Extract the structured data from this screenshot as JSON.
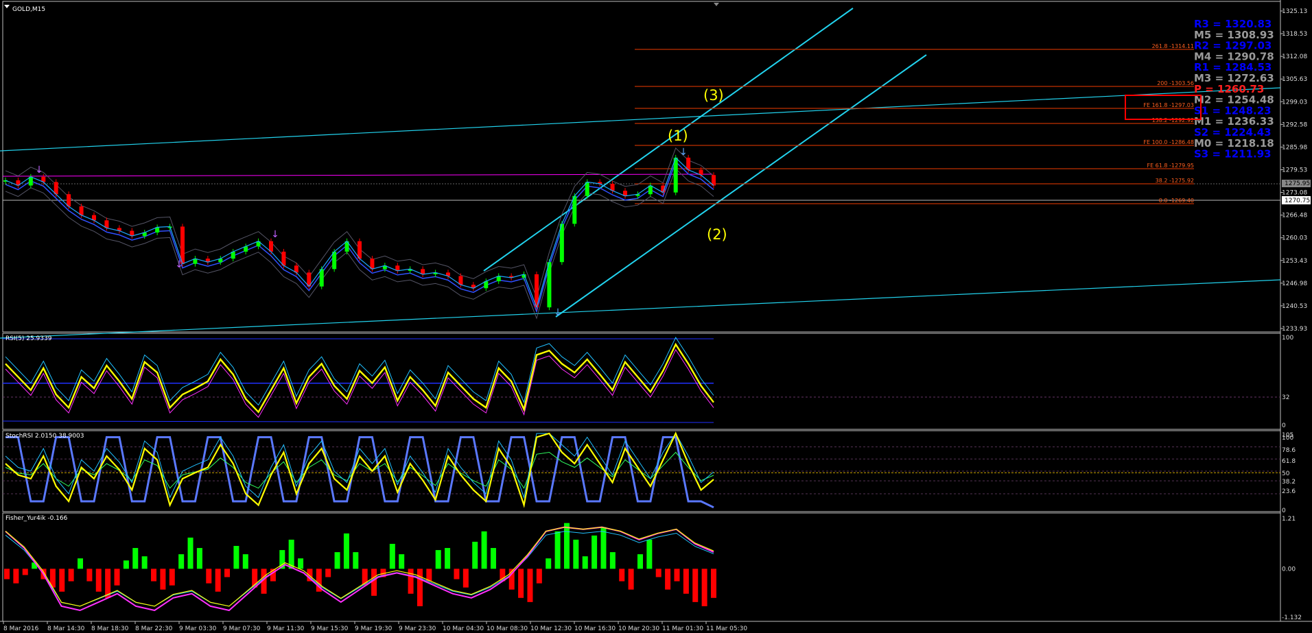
{
  "window": {
    "title": "GOLD,M15"
  },
  "colors": {
    "background": "#000000",
    "grid": "#1a1a1a",
    "panel_border": "#c0c0c0",
    "bull": "#00ff00",
    "bear": "#ff0000",
    "channel": "#22d3ee",
    "pivot_blue": "#0000ff",
    "pivot_grey": "#9a9a9a",
    "pivot_red": "#ff2020",
    "fib": "#c03000",
    "fib_text": "#ff6020",
    "wave": "#ffff00",
    "ma_magenta": "#ff00ff"
  },
  "price_axis": {
    "ticks": [
      "1325.13",
      "1318.53",
      "1312.08",
      "1305.63",
      "1299.03",
      "1292.58",
      "1285.98",
      "1279.53",
      "1273.08",
      "1266.48",
      "1260.03",
      "1253.43",
      "1246.98",
      "1240.53",
      "1233.93"
    ],
    "current_price": "1270.75",
    "bid_box": "1275.95"
  },
  "time_axis": [
    "8 Mar 2016",
    "8 Mar 14:30",
    "8 Mar 18:30",
    "8 Mar 22:30",
    "9 Mar 03:30",
    "9 Mar 07:30",
    "9 Mar 11:30",
    "9 Mar 15:30",
    "9 Mar 19:30",
    "9 Mar 23:30",
    "10 Mar 04:30",
    "10 Mar 08:30",
    "10 Mar 12:30",
    "10 Mar 16:30",
    "10 Mar 20:30",
    "11 Mar 01:30",
    "11 Mar 05:30"
  ],
  "pivots": [
    {
      "label": "R3 = 1320.83",
      "color": "blue"
    },
    {
      "label": "M5 = 1308.93",
      "color": "grey"
    },
    {
      "label": "R2 = 1297.03",
      "color": "blue"
    },
    {
      "label": "M4 = 1290.78",
      "color": "grey"
    },
    {
      "label": "R1 = 1284.53",
      "color": "blue"
    },
    {
      "label": "M3 = 1272.63",
      "color": "grey"
    },
    {
      "label": "P = 1260.73",
      "color": "red"
    },
    {
      "label": "M2 = 1254.48",
      "color": "grey"
    },
    {
      "label": "S1 = 1248.23",
      "color": "blue"
    },
    {
      "label": "M1 = 1236.33",
      "color": "grey"
    },
    {
      "label": "S2 = 1224.43",
      "color": "blue"
    },
    {
      "label": "M0 = 1218.18",
      "color": "grey"
    },
    {
      "label": "S3 = 1211.93",
      "color": "blue"
    }
  ],
  "fib_levels": [
    {
      "label": "261.8 -1314.11"
    },
    {
      "label": "200 -1303.56"
    },
    {
      "label": "FE 161.8 -1297.03"
    },
    {
      "label": "138.2 -1292.92"
    },
    {
      "label": "FE 100.0 -1286.48"
    },
    {
      "label": "FE 61.8 -1279.95"
    },
    {
      "label": "38.2 -1275.92"
    },
    {
      "label": "0.0 -1269.40"
    }
  ],
  "waves": [
    "(1)",
    "(2)",
    "(3)"
  ],
  "chart_data": [
    {
      "type": "line",
      "title": "GOLD,M15",
      "ylim": [
        1233.93,
        1325.13
      ],
      "series": [
        {
          "name": "GOLD",
          "values": [
            1276.5,
            1275,
            1277.5,
            1276,
            1272.5,
            1269,
            1266.5,
            1265,
            1262.8,
            1262,
            1260.5,
            1261.5,
            1263,
            1263.2,
            1252.5,
            1254,
            1253,
            1254,
            1256,
            1257.5,
            1259,
            1256,
            1252,
            1250,
            1246,
            1251,
            1256,
            1259,
            1254,
            1251,
            1252,
            1250.5,
            1251,
            1249.5,
            1250,
            1249,
            1246.5,
            1245.5,
            1247.5,
            1249,
            1248.5,
            1249.5,
            1240,
            1253,
            1264,
            1272,
            1276,
            1275.5,
            1273.5,
            1272,
            1272.5,
            1275,
            1273,
            1283,
            1279.5,
            1278,
            1275
          ]
        }
      ]
    },
    {
      "type": "line",
      "title": "RSI(5) 25.9339",
      "ylim": [
        0,
        100
      ],
      "y_ticks": [
        "100",
        "32",
        "0"
      ],
      "series": [
        {
          "name": "RSI(5)",
          "values": [
            70,
            55,
            40,
            65,
            35,
            20,
            55,
            42,
            68,
            50,
            30,
            72,
            60,
            20,
            35,
            42,
            50,
            75,
            58,
            30,
            15,
            40,
            65,
            25,
            55,
            70,
            45,
            30,
            62,
            48,
            66,
            28,
            55,
            40,
            22,
            60,
            45,
            30,
            20,
            65,
            50,
            18,
            80,
            85,
            70,
            60,
            75,
            58,
            40,
            72,
            55,
            38,
            62,
            92,
            70,
            45,
            26
          ]
        }
      ]
    },
    {
      "type": "line",
      "title": "StochRSI 2.0150 38.9003",
      "y_ticks": [
        "105",
        "78.6",
        "61.8",
        "50",
        "38.2",
        "23.6",
        "0",
        "100"
      ],
      "series": [
        {
          "name": "StochRSI",
          "values": [
            60,
            45,
            40,
            70,
            30,
            10,
            55,
            40,
            70,
            52,
            25,
            80,
            65,
            5,
            40,
            48,
            55,
            85,
            60,
            20,
            5,
            45,
            75,
            20,
            60,
            80,
            40,
            25,
            70,
            50,
            70,
            22,
            60,
            38,
            12,
            70,
            45,
            25,
            10,
            80,
            55,
            5,
            95,
            100,
            75,
            60,
            85,
            60,
            35,
            80,
            55,
            30,
            65,
            100,
            60,
            25,
            39
          ]
        },
        {
          "name": "StochRSI K",
          "values": [
            95,
            95,
            10,
            10,
            95,
            95,
            10,
            10,
            95,
            95,
            10,
            10,
            95,
            95,
            10,
            10,
            95,
            95,
            10,
            10,
            95,
            95,
            10,
            10,
            95,
            95,
            10,
            10,
            95,
            95,
            10,
            10,
            95,
            95,
            10,
            10,
            95,
            95,
            10,
            10,
            95,
            95,
            10,
            10,
            95,
            95,
            10,
            10,
            95,
            95,
            10,
            10,
            95,
            95,
            10,
            10,
            2
          ]
        }
      ]
    },
    {
      "type": "bar",
      "title": "Fisher_Yur4ik -0.166",
      "ylim": [
        -1.132,
        1.21
      ],
      "y_ticks": [
        "1.21",
        "0.00",
        "-1.132"
      ],
      "values": [
        -0.25,
        -0.35,
        -0.15,
        0.15,
        -0.25,
        -0.45,
        -0.55,
        -0.3,
        0.25,
        -0.3,
        -0.55,
        -0.7,
        -0.4,
        0.2,
        0.5,
        0.3,
        -0.3,
        -0.5,
        -0.4,
        0.35,
        0.75,
        0.5,
        -0.35,
        -0.55,
        -0.2,
        0.55,
        0.35,
        -0.45,
        -0.6,
        -0.3,
        0.45,
        0.7,
        0.25,
        -0.3,
        -0.55,
        -0.2,
        0.4,
        0.85,
        0.4,
        -0.4,
        -0.65,
        -0.2,
        0.6,
        0.35,
        -0.6,
        -0.9,
        -0.3,
        0.45,
        0.5,
        -0.25,
        -0.45,
        0.65,
        0.9,
        0.5,
        -0.3,
        -0.5,
        -0.7,
        -0.8,
        -0.35,
        0.25,
        0.9,
        1.1,
        0.7,
        0.3,
        0.8,
        1.0,
        0.4,
        -0.3,
        -0.5,
        0.35,
        0.7,
        -0.2,
        -0.5,
        -0.3,
        -0.6,
        -0.8,
        -0.9,
        -0.7
      ],
      "series": [
        {
          "name": "Fisher",
          "values": [
            0.9,
            0.5,
            -0.1,
            -0.9,
            -1.0,
            -0.8,
            -0.6,
            -0.9,
            -1.0,
            -0.7,
            -0.6,
            -0.9,
            -1.0,
            -0.6,
            -0.2,
            0.1,
            -0.1,
            -0.5,
            -0.8,
            -0.5,
            -0.2,
            -0.1,
            -0.2,
            -0.4,
            -0.6,
            -0.7,
            -0.5,
            -0.2,
            0.3,
            0.9,
            1.0,
            0.95,
            1.0,
            0.9,
            0.7,
            0.85,
            0.95,
            0.6,
            0.4
          ]
        }
      ]
    }
  ]
}
